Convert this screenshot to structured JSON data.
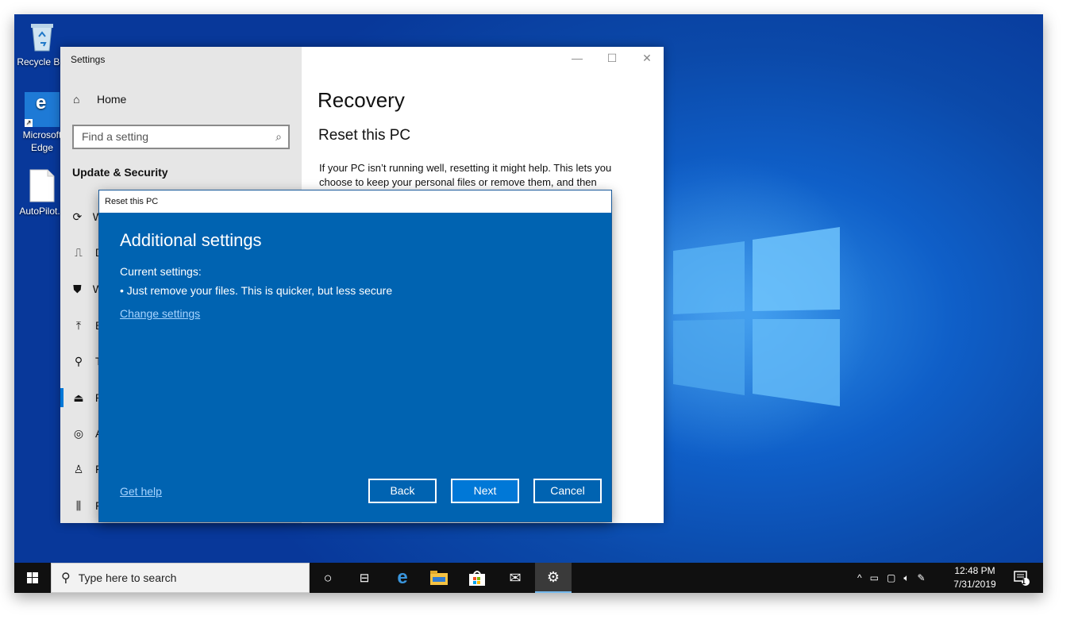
{
  "desktop": {
    "icons": [
      {
        "label": "Recycle Bin",
        "icon": "recycle-bin-icon"
      },
      {
        "label": "Microsoft Edge",
        "icon": "edge-icon"
      },
      {
        "label": "AutoPilot.c",
        "icon": "file-icon"
      }
    ]
  },
  "settings": {
    "title": "Settings",
    "home_label": "Home",
    "search_placeholder": "Find a setting",
    "section_title": "Update & Security",
    "nav_items": [
      {
        "label": "W",
        "icon": "sync-icon"
      },
      {
        "label": "D",
        "icon": "delivery-icon"
      },
      {
        "label": "W",
        "icon": "shield-icon"
      },
      {
        "label": "B",
        "icon": "backup-icon"
      },
      {
        "label": "T",
        "icon": "wrench-icon"
      },
      {
        "label": "R",
        "icon": "recovery-icon"
      },
      {
        "label": "A",
        "icon": "activation-icon"
      },
      {
        "label": "F",
        "icon": "find-device-icon"
      },
      {
        "label": "F",
        "icon": "developer-icon"
      }
    ],
    "page_title": "Recovery",
    "section_heading": "Reset this PC",
    "description": "If your PC isn’t running well, resetting it might help. This lets you choose to keep your personal files or remove them, and then"
  },
  "dialog": {
    "title": "Reset this PC",
    "heading": "Additional settings",
    "current_label": "Current settings:",
    "bullet": "•  Just remove your files. This is quicker, but less secure",
    "change_link": "Change settings",
    "help_link": "Get help",
    "back_label": "Back",
    "next_label": "Next",
    "cancel_label": "Cancel"
  },
  "taskbar": {
    "search_placeholder": "Type here to search",
    "time": "12:48 PM",
    "date": "7/31/2019",
    "notification_count": "1"
  }
}
